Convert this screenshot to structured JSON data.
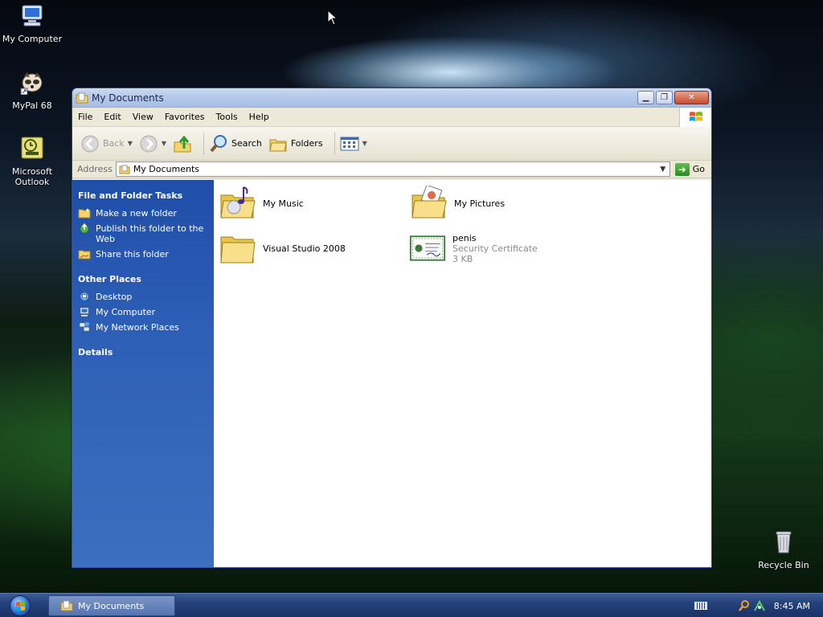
{
  "desktop": {
    "icons": [
      {
        "label": "My Computer"
      },
      {
        "label": "MyPal 68"
      },
      {
        "label": "Microsoft Outlook"
      },
      {
        "label": "Recycle Bin"
      }
    ]
  },
  "window": {
    "title": "My Documents",
    "menu": [
      "File",
      "Edit",
      "View",
      "Favorites",
      "Tools",
      "Help"
    ],
    "toolbar": {
      "back": "Back",
      "search": "Search",
      "folders": "Folders"
    },
    "address": {
      "label": "Address",
      "value": "My Documents",
      "go": "Go"
    },
    "taskpane": {
      "file_tasks": {
        "title": "File and Folder Tasks",
        "items": [
          "Make a new folder",
          "Publish this folder to the Web",
          "Share this folder"
        ]
      },
      "other_places": {
        "title": "Other Places",
        "items": [
          "Desktop",
          "My Computer",
          "My Network Places"
        ]
      },
      "details": {
        "title": "Details"
      }
    },
    "items": [
      {
        "name": "My Music"
      },
      {
        "name": "My Pictures"
      },
      {
        "name": "Visual Studio 2008"
      },
      {
        "name": "penis",
        "type": "Security Certificate",
        "size": "3 KB"
      }
    ]
  },
  "taskbar": {
    "task_label": "My Documents",
    "clock": "8:45 AM"
  },
  "colors": {
    "taskpane": "#2e5fb7",
    "taskbar": "#24427b",
    "titlebar": "#b6c9ea"
  }
}
